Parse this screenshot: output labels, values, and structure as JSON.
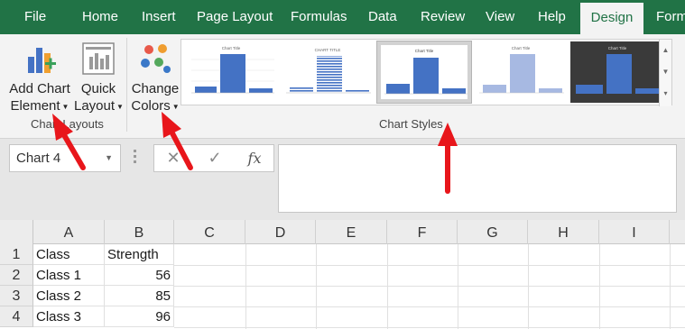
{
  "ribbon": {
    "tabs": [
      {
        "label": "File"
      },
      {
        "label": "Home"
      },
      {
        "label": "Insert"
      },
      {
        "label": "Page Layout"
      },
      {
        "label": "Formulas"
      },
      {
        "label": "Data"
      },
      {
        "label": "Review"
      },
      {
        "label": "View"
      },
      {
        "label": "Help"
      },
      {
        "label": "Design"
      },
      {
        "label": "Form"
      }
    ],
    "active_tab": "Design",
    "chart_layouts": {
      "add_chart_element": {
        "line1": "Add Chart",
        "line2": "Element",
        "icon": "add-chart-element-icon"
      },
      "quick_layout": {
        "line1": "Quick",
        "line2": "Layout",
        "icon": "quick-layout-icon"
      },
      "group_label": "Chart Layouts"
    },
    "change_colors": {
      "line1": "Change",
      "line2": "Colors",
      "icon": "color-palette-icon"
    },
    "chart_styles": {
      "group_label": "Chart Styles",
      "thumbnails": [
        {
          "title": "Chart Title"
        },
        {
          "title": "CHART TITLE"
        },
        {
          "title": "Chart Title"
        },
        {
          "title": "Chart Title"
        },
        {
          "title": "Chart Title"
        }
      ],
      "selected_index": 2
    }
  },
  "formula_bar": {
    "name_box": "Chart 4",
    "cancel_symbol": "✕",
    "enter_symbol": "✓",
    "fx_label": "fx",
    "formula": ""
  },
  "sheet": {
    "columns": [
      "A",
      "B",
      "C",
      "D",
      "E",
      "F",
      "G",
      "H",
      "I"
    ],
    "rows": [
      {
        "num": "1",
        "a": "Class",
        "b": "Strength"
      },
      {
        "num": "2",
        "a": "Class 1",
        "b": "56"
      },
      {
        "num": "3",
        "a": "Class 2",
        "b": "85"
      },
      {
        "num": "4",
        "a": "Class 3",
        "b": "96"
      }
    ]
  },
  "colors": {
    "ribbon_green": "#217346",
    "accent_blue": "#4472c4",
    "annotation_red": "#e8161b"
  }
}
